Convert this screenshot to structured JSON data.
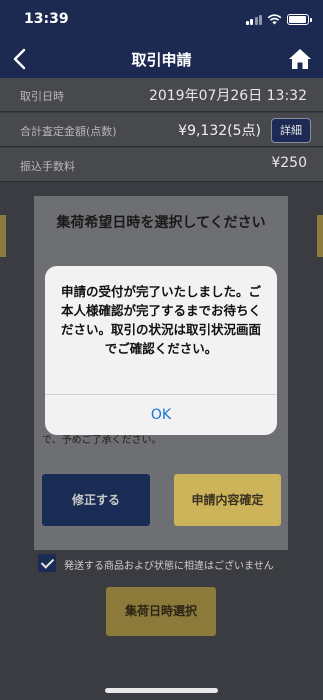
{
  "status": {
    "time": "13:39"
  },
  "nav": {
    "title": "取引申請"
  },
  "rows": [
    {
      "label": "取引日時",
      "value": "2019年07月26日 13:32"
    },
    {
      "label": "合計査定金額(点数)",
      "value": "¥9,132(5点)",
      "button": "詳細"
    },
    {
      "label": "振込手数料",
      "value": "¥250"
    }
  ],
  "sheet": {
    "title": "集荷希望日時を選択してください",
    "note": "で、予めご了承ください。",
    "fix_button": "修正する",
    "confirm_button": "申請内容確定"
  },
  "agree": {
    "text": "発送する商品および状態に相違はございません",
    "checked": true
  },
  "pickup_button": "集荷日時選択",
  "alert": {
    "message": "申請の受付が完了いたしました。ご本人様確認が完了するまでお待ちください。取引の状況は取引状況画面でご確認ください。",
    "ok": "OK"
  },
  "colors": {
    "navy": "#1c2a52",
    "gold": "#cdb45a",
    "link": "#1a73d9"
  },
  "icons": [
    "back-chevron-icon",
    "home-icon",
    "signal-icon",
    "wifi-icon",
    "battery-icon",
    "checkmark-icon"
  ]
}
